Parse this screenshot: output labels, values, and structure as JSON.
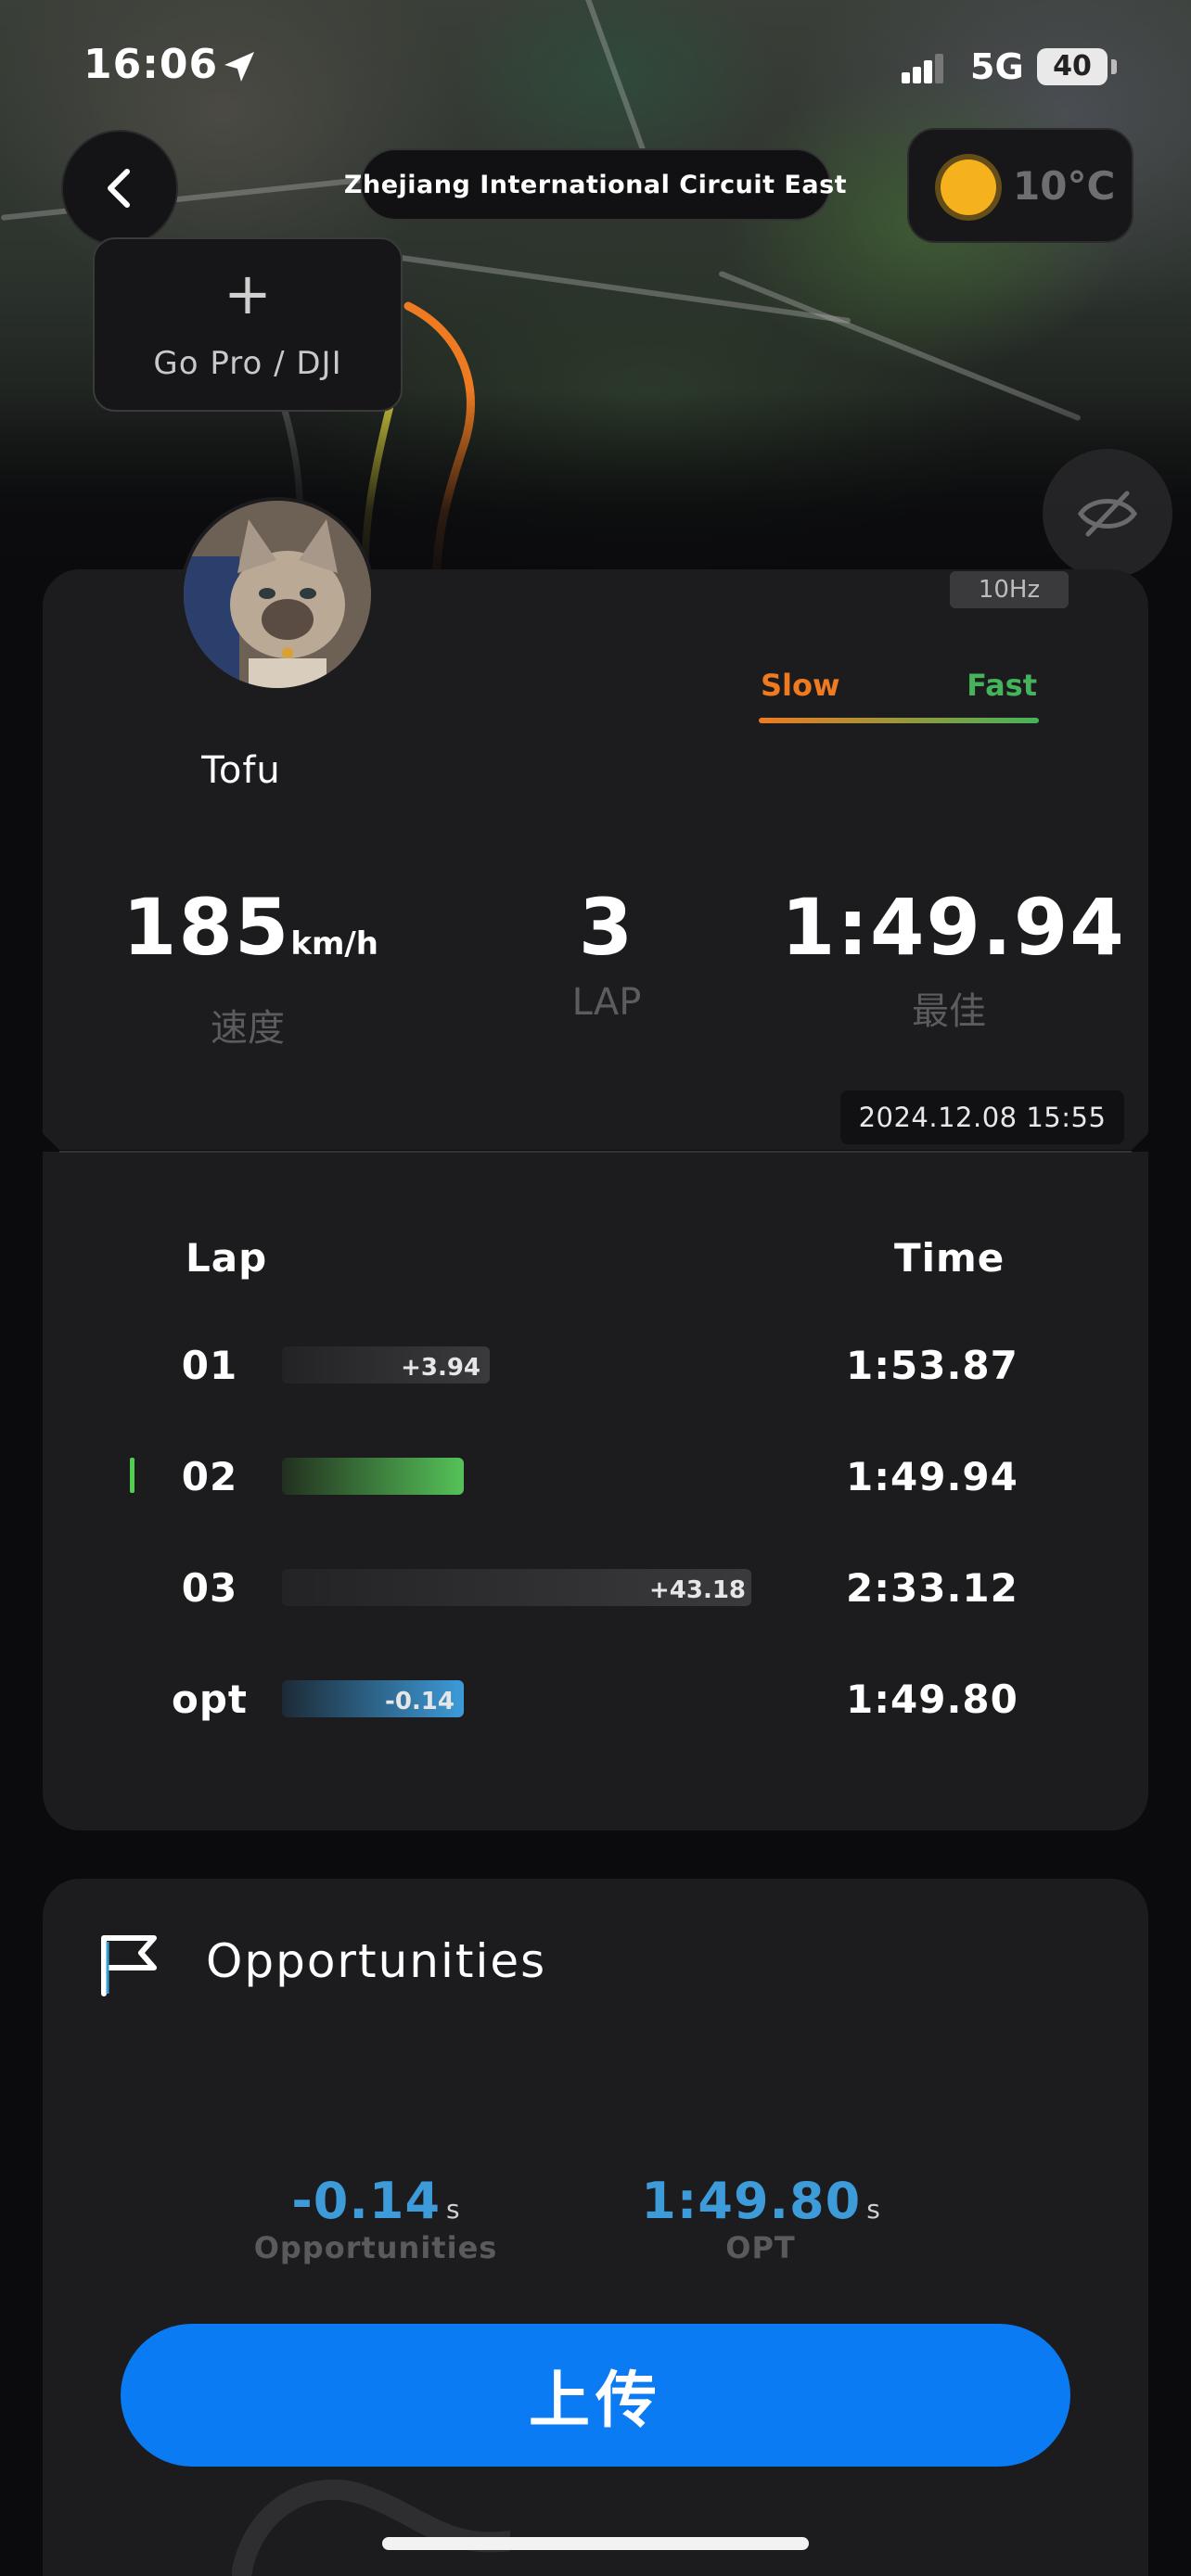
{
  "status_bar": {
    "time": "16:06",
    "network": "5G",
    "battery": "40"
  },
  "header": {
    "circuit_name": "Zhejiang International Circuit East",
    "temperature": "10°C",
    "gopro_label": "Go Pro / DJI",
    "gopro_plus": "+"
  },
  "profile": {
    "username": "Tofu",
    "sample_rate": "10Hz"
  },
  "legend": {
    "slow": "Slow",
    "fast": "Fast"
  },
  "stats": {
    "speed_value": "185",
    "speed_unit": "km/h",
    "speed_caption": "速度",
    "lap_value": "3",
    "lap_caption": "LAP",
    "best_value": "1:49.94",
    "best_caption": "最佳",
    "date": "2024.12.08 15:55"
  },
  "laps": {
    "header_lap": "Lap",
    "header_time": "Time",
    "rows": [
      {
        "lap": "01",
        "delta": "+3.94",
        "time": "1:53.87",
        "delta_value": 3.94,
        "best": false,
        "type": "lap"
      },
      {
        "lap": "02",
        "delta": "",
        "time": "1:49.94",
        "delta_value": 0,
        "best": true,
        "type": "lap"
      },
      {
        "lap": "03",
        "delta": "+43.18",
        "time": "2:33.12",
        "delta_value": 43.18,
        "best": false,
        "type": "lap"
      },
      {
        "lap": "opt",
        "delta": "-0.14",
        "time": "1:49.80",
        "delta_value": -0.14,
        "best": false,
        "type": "opt"
      }
    ]
  },
  "opportunities": {
    "title": "Opportunities",
    "gain_value": "-0.14",
    "gain_unit": "s",
    "gain_caption": "Opportunities",
    "opt_value": "1:49.80",
    "opt_unit": "s",
    "opt_caption": "OPT"
  },
  "actions": {
    "upload_label": "上传"
  },
  "colors": {
    "slow": "#ef7a20",
    "fast": "#45b35a",
    "accent_blue": "#0a7bf2",
    "opt_blue": "#3d9bd9"
  },
  "icons": {
    "back": "chevron-left-icon",
    "weather": "sun-icon",
    "location": "location-arrow-icon",
    "hide": "eye-slash-icon",
    "flag": "flag-icon"
  }
}
